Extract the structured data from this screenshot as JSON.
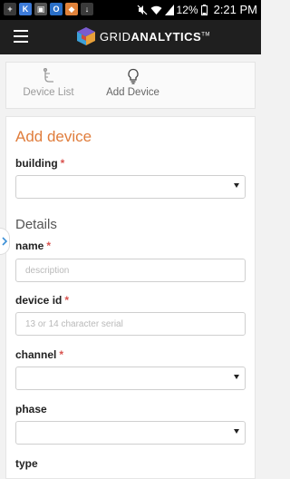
{
  "status_bar": {
    "notifications": [
      {
        "icon": "plus-icon",
        "glyph": "+",
        "color": "#3a3a3a"
      },
      {
        "icon": "k-app-icon",
        "glyph": "K",
        "color": "#3d7bd9"
      },
      {
        "icon": "contacts-icon",
        "glyph": "▣",
        "color": "#555555"
      },
      {
        "icon": "outlook-icon",
        "glyph": "O",
        "color": "#2a6fc7"
      },
      {
        "icon": "app-icon",
        "glyph": "◆",
        "color": "#e0823a"
      },
      {
        "icon": "download-icon",
        "glyph": "↓",
        "color": "#3a3a3a"
      }
    ],
    "battery": "12%",
    "time": "2:21 PM"
  },
  "app_bar": {
    "brand_light": "GRID",
    "brand_bold": "ANALYTICS",
    "trademark": "TM"
  },
  "tabs": [
    {
      "label": "Device List",
      "icon": "device-list-icon"
    },
    {
      "label": "Add Device",
      "icon": "lightbulb-icon"
    }
  ],
  "form": {
    "title": "Add device",
    "building_label": "building",
    "building_value": "",
    "details_title": "Details",
    "name_label": "name",
    "name_placeholder": "description",
    "device_id_label": "device id",
    "device_id_placeholder": "13 or 14 character serial",
    "channel_label": "channel",
    "channel_value": "",
    "phase_label": "phase",
    "phase_value": "",
    "type_label": "type"
  },
  "colors": {
    "accent": "#e07d3c",
    "required": "#d9534f",
    "edge_arrow": "#3a8fd6"
  }
}
